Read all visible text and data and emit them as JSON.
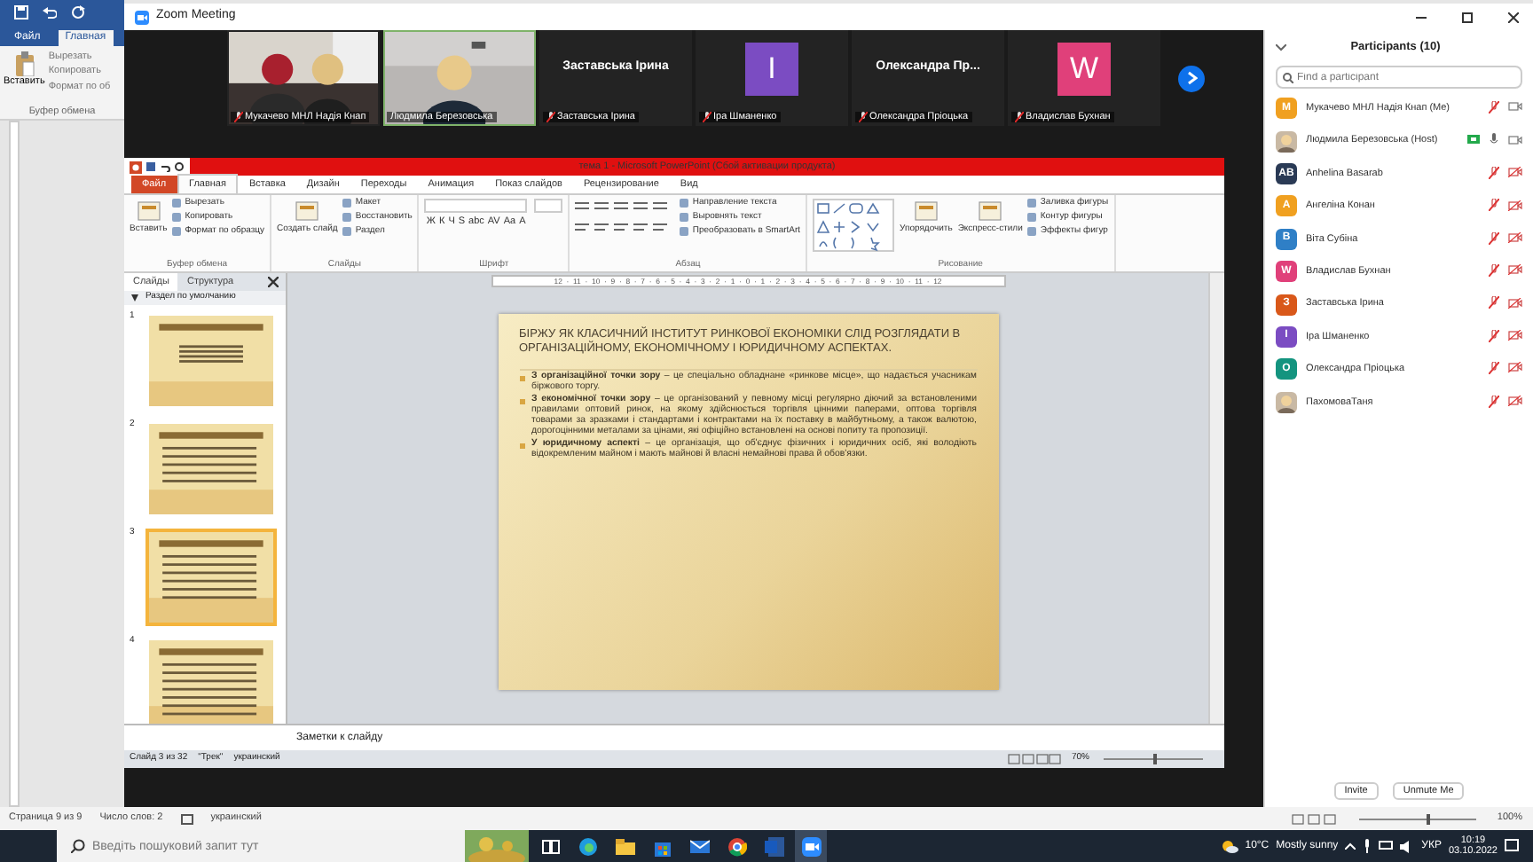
{
  "word": {
    "tabs": [
      {
        "label": "Файл",
        "selected": false
      },
      {
        "label": "Главная",
        "selected": true
      }
    ],
    "clipboard": {
      "paste": "Вставить",
      "items": [
        "Вырезать",
        "Копировать",
        "Формат по об"
      ],
      "group": "Буфер обмена"
    },
    "status_bar": {
      "page": "Страница 9 из 9",
      "words": "Число слов: 2",
      "language": "украинский",
      "zoom": "100%"
    }
  },
  "zoom_window": {
    "title": "Zoom Meeting"
  },
  "video_tiles": [
    {
      "kind": "video",
      "label": "Мукачево МНЛ Надія Кнап",
      "muted": true,
      "speaking": false
    },
    {
      "kind": "video",
      "label": "Людмила Березовська",
      "muted": false,
      "speaking": true
    },
    {
      "kind": "name",
      "name": "Заставська Ірина",
      "label": "Заставська Ірина",
      "muted": true,
      "speaking": false
    },
    {
      "kind": "avatar",
      "initial": "I",
      "color": "#7b4cc2",
      "label": "Іра Шманенко",
      "muted": true,
      "speaking": false
    },
    {
      "kind": "name",
      "name": "Олександра Пр...",
      "label": "Олександра Пріоцька",
      "muted": true,
      "speaking": false
    },
    {
      "kind": "avatar",
      "initial": "W",
      "color": "#e0407a",
      "label": "Владислав Бухнан",
      "muted": true,
      "speaking": false
    }
  ],
  "powerpoint": {
    "title": "тема 1 - Microsoft PowerPoint (Сбой активации продукта)",
    "tabs": [
      {
        "label": "Файл",
        "selected": false,
        "kind": "file"
      },
      {
        "label": "Главная",
        "selected": true,
        "kind": "tab"
      },
      {
        "label": "Вставка",
        "selected": false,
        "kind": "tab"
      },
      {
        "label": "Дизайн",
        "selected": false,
        "kind": "tab"
      },
      {
        "label": "Переходы",
        "selected": false,
        "kind": "tab"
      },
      {
        "label": "Анимация",
        "selected": false,
        "kind": "tab"
      },
      {
        "label": "Показ слайдов",
        "selected": false,
        "kind": "tab"
      },
      {
        "label": "Рецензирование",
        "selected": false,
        "kind": "tab"
      },
      {
        "label": "Вид",
        "selected": false,
        "kind": "tab"
      }
    ],
    "ribbon_groups": [
      {
        "kind": "commands",
        "label": "Буфер обмена",
        "big": [
          "Вставить"
        ],
        "items": [
          "Вырезать",
          "Копировать",
          "Формат по образцу"
        ]
      },
      {
        "kind": "commands",
        "label": "Слайды",
        "big": [
          "Создать слайд"
        ],
        "items": [
          "Макет",
          "Восстановить",
          "Раздел"
        ]
      },
      {
        "kind": "font",
        "label": "Шрифт",
        "buttons": [
          "Ж",
          "К",
          "Ч",
          "S",
          "abc",
          "AV",
          "Aa",
          "A"
        ]
      },
      {
        "kind": "paragraph",
        "label": "Абзац",
        "items": [
          "Направление текста",
          "Выровнять текст",
          "Преобразовать в SmartArt"
        ]
      },
      {
        "kind": "drawing",
        "label": "Рисование",
        "big": [
          "Упорядочить",
          "Экспресс-стили"
        ],
        "items": [
          "Заливка фигуры",
          "Контур фигуры",
          "Эффекты фигур"
        ]
      }
    ],
    "pane_tabs": [
      {
        "label": "Слайды",
        "selected": true
      },
      {
        "label": "Структура",
        "selected": false
      }
    ],
    "section": "Раздел по умолчанию",
    "thumbnails": [
      {
        "number": "1",
        "selected": false
      },
      {
        "number": "2",
        "selected": false
      },
      {
        "number": "3",
        "selected": true
      },
      {
        "number": "4",
        "selected": false
      }
    ],
    "ruler": "12 · 11 · 10 · 9 · 8 · 7 · 6 · 5 · 4 · 3 · 2 · 1 · 0 · 1 · 2 · 3 · 4 · 5 · 6 · 7 · 8 · 9 · 10 · 11 · 12",
    "slide": {
      "title": "БІРЖУ ЯК КЛАСИЧНИЙ ІНСТИТУТ РИНКОВОЇ ЕКОНОМІКИ СЛІД РОЗГЛЯДАТИ В ОРГАНІЗАЦІЙНОМУ, ЕКОНОМІЧНОМУ І ЮРИДИЧНОМУ АСПЕКТАХ.",
      "bullets": [
        "**З організаційної точки зору** – це спеціально обладнане «ринкове місце», що надається учасникам біржового торгу.",
        "**З економічної точки зору** – це організований у певному місці регулярно діючий за встановленими правилами оптовий ринок, на якому здійснюється торгівля цінними паперами, оптова торгівля товарами за зразками і стандартами і контрактами на їх поставку в майбутньому, а також валютою, дорогоцінними металами за цінами, які офіційно встановлені на основі попиту та пропозиції.",
        "**У юридичному аспекті** – це організація, що об'єднує фізичних і юридичних осіб, які володіють відокремленим майном і мають майнові й власні немайнові права й обов'язки."
      ]
    },
    "notes_placeholder": "Заметки к слайду",
    "status_bar": {
      "slide": "Слайд 3 из 32",
      "theme": "\"Трек\"",
      "language": "украинский",
      "zoom": "70%"
    }
  },
  "participants": {
    "title": "Participants (10)",
    "search_placeholder": "Find a participant",
    "items": [
      {
        "name": "Мукачево МНЛ Надія Кнап (Me)",
        "kind": "initials",
        "initial": "M",
        "color": "#f0a020",
        "muted": true,
        "video_off": false,
        "sharing": false
      },
      {
        "name": "Людмила Березовська (Host)",
        "muted": false,
        "video_off": false,
        "sharing": true
      },
      {
        "name": "Anhelina Basarab",
        "kind": "initials",
        "initial": "AB",
        "color": "#2a3a55",
        "muted": true,
        "video_off": true,
        "sharing": false
      },
      {
        "name": "Ангеліна Конан",
        "kind": "initials",
        "initial": "A",
        "color": "#f0a020",
        "muted": true,
        "video_off": true,
        "sharing": false
      },
      {
        "name": "Віта Субіна",
        "kind": "initials",
        "initial": "B",
        "color": "#2f7fc6",
        "muted": true,
        "video_off": true,
        "sharing": false
      },
      {
        "name": "Владислав Бухнан",
        "kind": "initials",
        "initial": "W",
        "color": "#e0407a",
        "muted": true,
        "video_off": true,
        "sharing": false
      },
      {
        "name": "Заставська Ірина",
        "kind": "initials",
        "initial": "З",
        "color": "#d9581a",
        "muted": true,
        "video_off": true,
        "sharing": false
      },
      {
        "name": "Іра Шманенко",
        "kind": "initials",
        "initial": "I",
        "color": "#7b4cc2",
        "muted": true,
        "video_off": true,
        "sharing": false
      },
      {
        "name": "Олександра Пріоцька",
        "kind": "initials",
        "initial": "O",
        "color": "#14947f",
        "muted": true,
        "video_off": true,
        "sharing": false
      },
      {
        "name": "ПахомоваТаня",
        "muted": true,
        "video_off": true,
        "sharing": false
      }
    ],
    "buttons": [
      "Invite",
      "Unmute Me"
    ]
  },
  "taskbar": {
    "search_placeholder": "Введіть пошуковий запит тут",
    "temperature": "10°C",
    "weather": "Mostly sunny",
    "language": "УКР",
    "time": "10:19",
    "date": "03.10.2022"
  }
}
